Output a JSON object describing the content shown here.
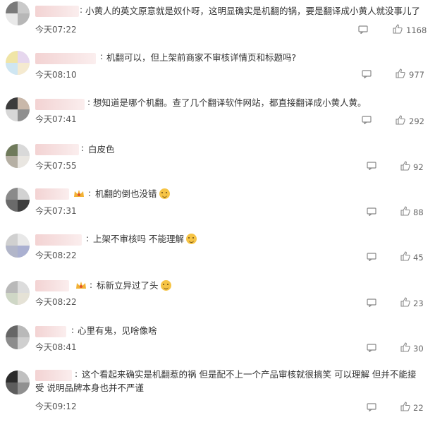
{
  "comments": [
    {
      "text": "小黄人的英文原意就是奴仆呀，这明显确实是机翻的锅，要是翻译成小黄人就没事儿了",
      "time": "今天07:22",
      "likes": "1168",
      "avatar_colors": [
        "#7a7a7a",
        "#c9c9c9",
        "#e9e9e9",
        "#b7b7b7"
      ]
    },
    {
      "text": "机翻可以，但上架前商家不审核详情页和标题吗?",
      "time": "今天08:10",
      "likes": "977",
      "avatar_colors": [
        "#f0e5a6",
        "#e6d7ee",
        "#cfe6f2",
        "#f5ead0"
      ]
    },
    {
      "text": "想知道是哪个机翻。查了几个翻译软件网站，都直接翻译成小黄人黄。",
      "time": "今天07:41",
      "likes": "292",
      "avatar_colors": [
        "#3c3c3c",
        "#c9b8aa",
        "#d7d7d7",
        "#8f8f8f"
      ]
    },
    {
      "text": "白皮色",
      "time": "今天07:55",
      "likes": "92",
      "avatar_colors": [
        "#6f7a5b",
        "#d9d9d9",
        "#b6b0a4",
        "#e9e6e1"
      ]
    },
    {
      "text": "机翻的倒也没错",
      "time": "今天07:31",
      "likes": "88",
      "avatar_colors": [
        "#8a8a8a",
        "#d2d2d2",
        "#6a6a6a",
        "#3e3e3e"
      ]
    },
    {
      "text": "上架不审核吗 不能理解",
      "time": "今天08:22",
      "likes": "45",
      "avatar_colors": [
        "#d0d0d0",
        "#e8e8e8",
        "#b2b6c9",
        "#aab0d1"
      ]
    },
    {
      "text": "标新立异过了头",
      "time": "今天08:22",
      "likes": "23",
      "avatar_colors": [
        "#b9b9b9",
        "#dcdcdc",
        "#cfd7c6",
        "#e5e2d6"
      ]
    },
    {
      "text": "心里有鬼，见啥像啥",
      "time": "今天08:41",
      "likes": "30",
      "avatar_colors": [
        "#666666",
        "#b9b9b9",
        "#8c8c8c",
        "#cfcfcf"
      ]
    },
    {
      "text": "这个看起来确实是机翻惹的祸 但是配不上一个产品审核就很搞笑 可以理解 但并不能接受 说明品牌本身也并不严谨",
      "time": "今天09:12",
      "likes": "22",
      "avatar_colors": [
        "#2b2b2b",
        "#c0c0c0",
        "#5d5d5d",
        "#909090"
      ]
    }
  ],
  "icons": {
    "reply": "comment-icon",
    "like": "thumbs-up-icon",
    "emoji": "laughing-emoji-icon",
    "badge": "crown-badge-icon"
  },
  "colors": {
    "text": "#333333",
    "meta": "#666666",
    "icon": "#888888"
  }
}
